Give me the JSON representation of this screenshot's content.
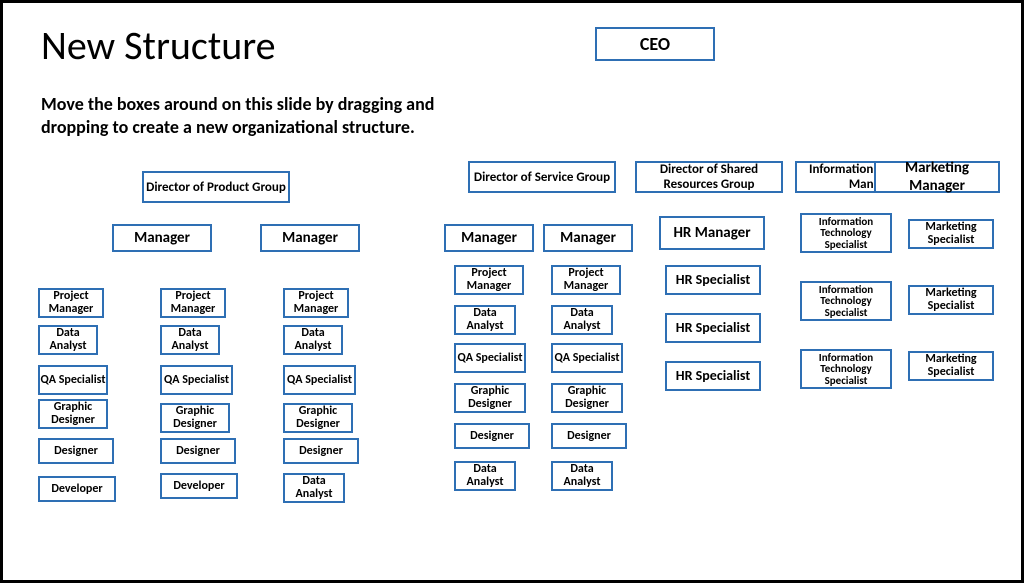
{
  "title": "New Structure",
  "subtitle": "Move the boxes around on this slide by dragging and dropping to create a new organizational structure.",
  "boxes": {
    "ceo": "CEO",
    "dir_product": "Director of\nProduct Group",
    "dir_service": "Director of Service\nGroup",
    "dir_shared": "Director of Shared\nResources Group",
    "it_manager": "Information\nTechnology Manager",
    "mkt_manager": "Marketing\nManager",
    "mgrA": "Manager",
    "mgrB": "Manager",
    "a_pm": "Project\nManager",
    "a_da": "Data\nAnalyst",
    "a_qa": "QA\nSpecialist",
    "a_gd": "Graphic\nDesigner",
    "a_des": "Designer",
    "a_dev": "Developer",
    "b_pm": "Project\nManager",
    "b_da": "Data\nAnalyst",
    "b_qa": "QA\nSpecialist",
    "b_gd": "Graphic\nDesigner",
    "b_des": "Designer",
    "b_dev": "Developer",
    "c_pm": "Project\nManager",
    "c_da": "Data\nAnalyst",
    "c_qa": "QA\nSpecialist",
    "c_gd": "Graphic\nDesigner",
    "c_des": "Designer",
    "c_da2": "Data\nAnalyst",
    "svc_mgr1": "Manager",
    "svc_mgr2": "Manager",
    "s1_pm": "Project\nManager",
    "s1_da": "Data\nAnalyst",
    "s1_qa": "QA\nSpecialist",
    "s1_gd": "Graphic\nDesigner",
    "s1_des": "Designer",
    "s1_da2": "Data\nAnalyst",
    "s2_pm": "Project\nManager",
    "s2_da": "Data\nAnalyst",
    "s2_qa": "QA\nSpecialist",
    "s2_gd": "Graphic\nDesigner",
    "s2_des": "Designer",
    "s2_da2": "Data\nAnalyst",
    "hr_manager": "HR\nManager",
    "hr_sp1": "HR\nSpecialist",
    "hr_sp2": "HR\nSpecialist",
    "hr_sp3": "HR\nSpecialist",
    "it_sp1": "Information\nTechnology\nSpecialist",
    "it_sp2": "Information\nTechnology\nSpecialist",
    "it_sp3": "Information\nTechnology\nSpecialist",
    "mkt_sp1": "Marketing\nSpecialist",
    "mkt_sp2": "Marketing\nSpecialist",
    "mkt_sp3": "Marketing\nSpecialist"
  }
}
